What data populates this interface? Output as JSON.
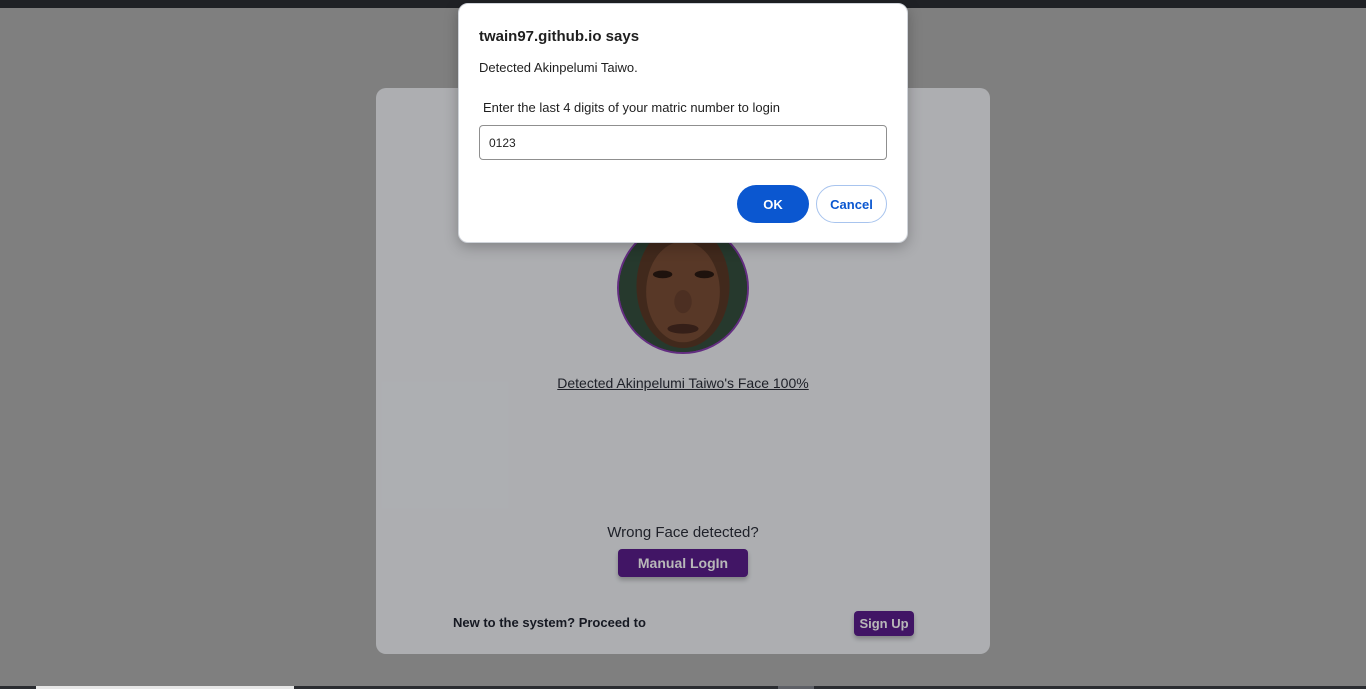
{
  "dialog": {
    "title": "twain97.github.io says",
    "message": "Detected Akinpelumi Taiwo.",
    "prompt": "Enter the last 4 digits of your matric number to login",
    "input_value": "0123",
    "ok_label": "OK",
    "cancel_label": "Cancel"
  },
  "card": {
    "detect_link": "Detected Akinpelumi Taiwo's Face 100%",
    "wrong_face": "Wrong Face detected?",
    "manual_login_label": "Manual LogIn",
    "new_system_text": "New to the system? Proceed to",
    "signup_label": "Sign Up"
  },
  "colors": {
    "primary_button": "#5a1e8c",
    "dialog_accent": "#0b57d0",
    "card_background": "#f0f2f6"
  }
}
